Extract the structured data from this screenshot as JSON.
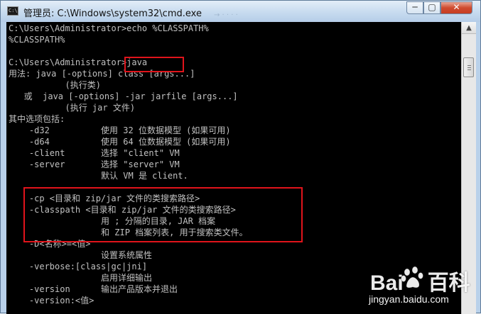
{
  "window": {
    "title": "管理员: C:\\Windows\\system32\\cmd.exe",
    "icon_text": "C:\\",
    "background_ghost_text": "→ · · · ·",
    "controls": {
      "minimize": "─",
      "maximize": "▢",
      "close": "✕"
    }
  },
  "console": {
    "lines": [
      "C:\\Users\\Administrator>echo %CLASSPATH%",
      "%CLASSPATH%",
      "",
      "C:\\Users\\Administrator>java",
      "用法: java [-options] class [args...]",
      "           (执行类)",
      "   或  java [-options] -jar jarfile [args...]",
      "           (执行 jar 文件)",
      "其中选项包括:",
      "    -d32          使用 32 位数据模型 (如果可用)",
      "    -d64          使用 64 位数据模型 (如果可用)",
      "    -client       选择 \"client\" VM",
      "    -server       选择 \"server\" VM",
      "                  默认 VM 是 client.",
      "",
      "    -cp <目录和 zip/jar 文件的类搜索路径>",
      "    -classpath <目录和 zip/jar 文件的类搜索路径>",
      "                  用 ; 分隔的目录, JAR 档案",
      "                  和 ZIP 档案列表, 用于搜索类文件。",
      "    -D<名称>=<值>",
      "                  设置系统属性",
      "    -verbose:[class|gc|jni]",
      "                  启用详细输出",
      "    -version      输出产品版本并退出",
      "    -version:<值>"
    ]
  },
  "scrollbar": {
    "up_arrow": "▲",
    "down_arrow": "▼"
  },
  "watermark": {
    "logo_left": "Bai",
    "logo_right": "百科",
    "url": "jingyan.baidu.com"
  },
  "colors": {
    "console_bg": "#000000",
    "console_fg": "#c0c0c0",
    "highlight": "#e0141b"
  }
}
